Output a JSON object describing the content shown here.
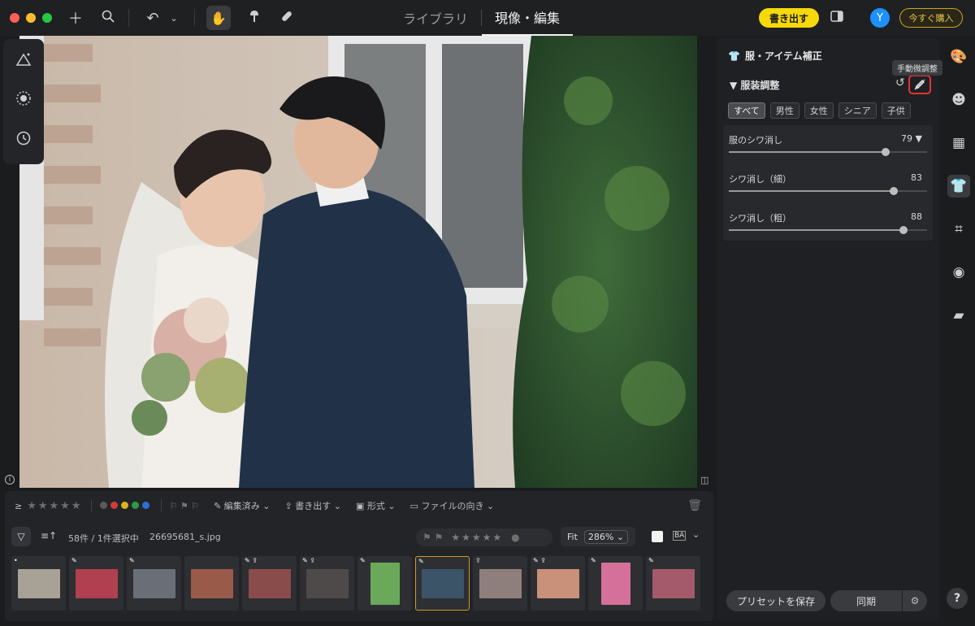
{
  "topbar": {
    "tabs": [
      {
        "label": "ライブラリ",
        "active": false
      },
      {
        "label": "現像・編集",
        "active": true
      }
    ],
    "export_label": "書き出す",
    "avatar_initial": "Y",
    "buy_label": "今すぐ購入",
    "icons": [
      "plus-icon",
      "search-icon",
      "undo-icon",
      "chevron-down-icon",
      "hand-icon",
      "brush-icon",
      "bandage-icon"
    ]
  },
  "left_tools": [
    "ai-triangle-icon",
    "focus-circle-icon",
    "history-icon"
  ],
  "filmstrip": {
    "toolbar": {
      "gte": "≥",
      "stars": "★★★★★",
      "color_labels": [
        "#5a5a5a",
        "#d23b3b",
        "#d9b420",
        "#2e9a46",
        "#2f6fd6"
      ],
      "edited_label": "編集済み",
      "export_label": "書き出す",
      "format_label": "形式",
      "orientation_label": "ファイルの向き"
    },
    "count_text": "58件 / 1件選択中",
    "file_name": "26695681_s.jpg",
    "rating_stars": "★★★★★",
    "zoom_fit": "Fit",
    "zoom_value": "286%",
    "ba_label": "BA",
    "thumbnails": [
      {
        "badge": "•",
        "color": "#a7a196",
        "tall": false
      },
      {
        "badge": "✎",
        "color": "#b04050",
        "tall": false
      },
      {
        "badge": "✎",
        "color": "#6a6e77",
        "tall": false
      },
      {
        "badge": "",
        "color": "#9a5a4a",
        "tall": false
      },
      {
        "badge": "✎ ⇪",
        "color": "#8a4b4b",
        "tall": false
      },
      {
        "badge": "✎ ⇪",
        "color": "#4f4a4a",
        "tall": false
      },
      {
        "badge": "✎",
        "color": "#6aa85a",
        "tall": true
      },
      {
        "badge": "✎",
        "color": "#3c5468",
        "tall": false,
        "selected": true
      },
      {
        "badge": "⇪",
        "color": "#8f7f7c",
        "tall": false
      },
      {
        "badge": "✎ ⇪",
        "color": "#c9907a",
        "tall": false
      },
      {
        "badge": "✎",
        "color": "#d4709a",
        "tall": true
      },
      {
        "badge": "✎",
        "color": "#a45a6a",
        "tall": false
      }
    ]
  },
  "right_panel": {
    "title": "服・アイテム補正",
    "tooltip": "手動微調整",
    "section": "服装調整",
    "chips": [
      {
        "label": "すべて",
        "active": true
      },
      {
        "label": "男性",
        "active": false
      },
      {
        "label": "女性",
        "active": false
      },
      {
        "label": "シニア",
        "active": false
      },
      {
        "label": "子供",
        "active": false
      }
    ],
    "sliders": [
      {
        "label": "服のシワ消し",
        "value": 79,
        "display": "79",
        "has_dropdown": true
      },
      {
        "label": "シワ消し（細）",
        "value": 83,
        "display": "83",
        "has_dropdown": false
      },
      {
        "label": "シワ消し（粗）",
        "value": 88,
        "display": "88",
        "has_dropdown": false
      }
    ],
    "preset_label": "プリセットを保存",
    "sync_label": "同期"
  },
  "rail": [
    "palette-icon",
    "face-icon",
    "gradient-icon",
    "shirt-icon",
    "crop-icon",
    "camera-icon",
    "folder-eye-icon"
  ],
  "help_label": "?"
}
